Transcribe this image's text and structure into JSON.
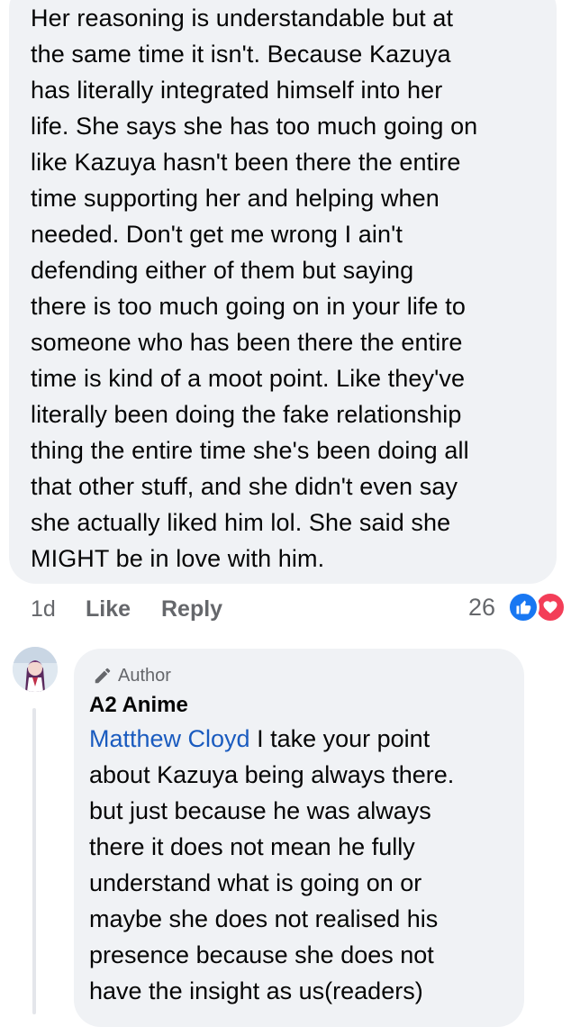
{
  "comment": {
    "lines": [
      "Her reasoning is understandable but at",
      "the same time it isn't.  Because Kazuya",
      "has literally integrated himself into her",
      "life. She says she has too much going on",
      "like Kazuya hasn't been there the entire",
      "time supporting her and helping when",
      "needed.  Don't get me wrong I ain't",
      "defending either of them but saying",
      "there is too much going on in your life to",
      "someone who has been there the entire",
      "time is kind of a moot point.  Like they've",
      "literally been doing the fake relationship",
      "thing the entire time she's been doing all",
      "that other stuff, and she didn't even say",
      "she actually liked him lol.  She said she",
      "MIGHT be in love with him."
    ],
    "time": "1d",
    "like_label": "Like",
    "reply_label": "Reply",
    "reaction_count": "26",
    "reactions": [
      "like-icon",
      "love-icon"
    ],
    "colors": {
      "like": "#1877f2",
      "love": "#f33e58"
    }
  },
  "reply": {
    "badge": "Author",
    "author": "A2 Anime",
    "mention": "Matthew Cloyd",
    "first_line_rest": " I take your point",
    "lines": [
      "about Kazuya being always there.",
      "but just because he was always",
      "there it does not mean he fully",
      "understand what is going on or",
      "maybe she does not realised his",
      "presence because she does not",
      "have the insight as us(readers)"
    ],
    "colors": {
      "mention": "#1a5bbf"
    }
  }
}
